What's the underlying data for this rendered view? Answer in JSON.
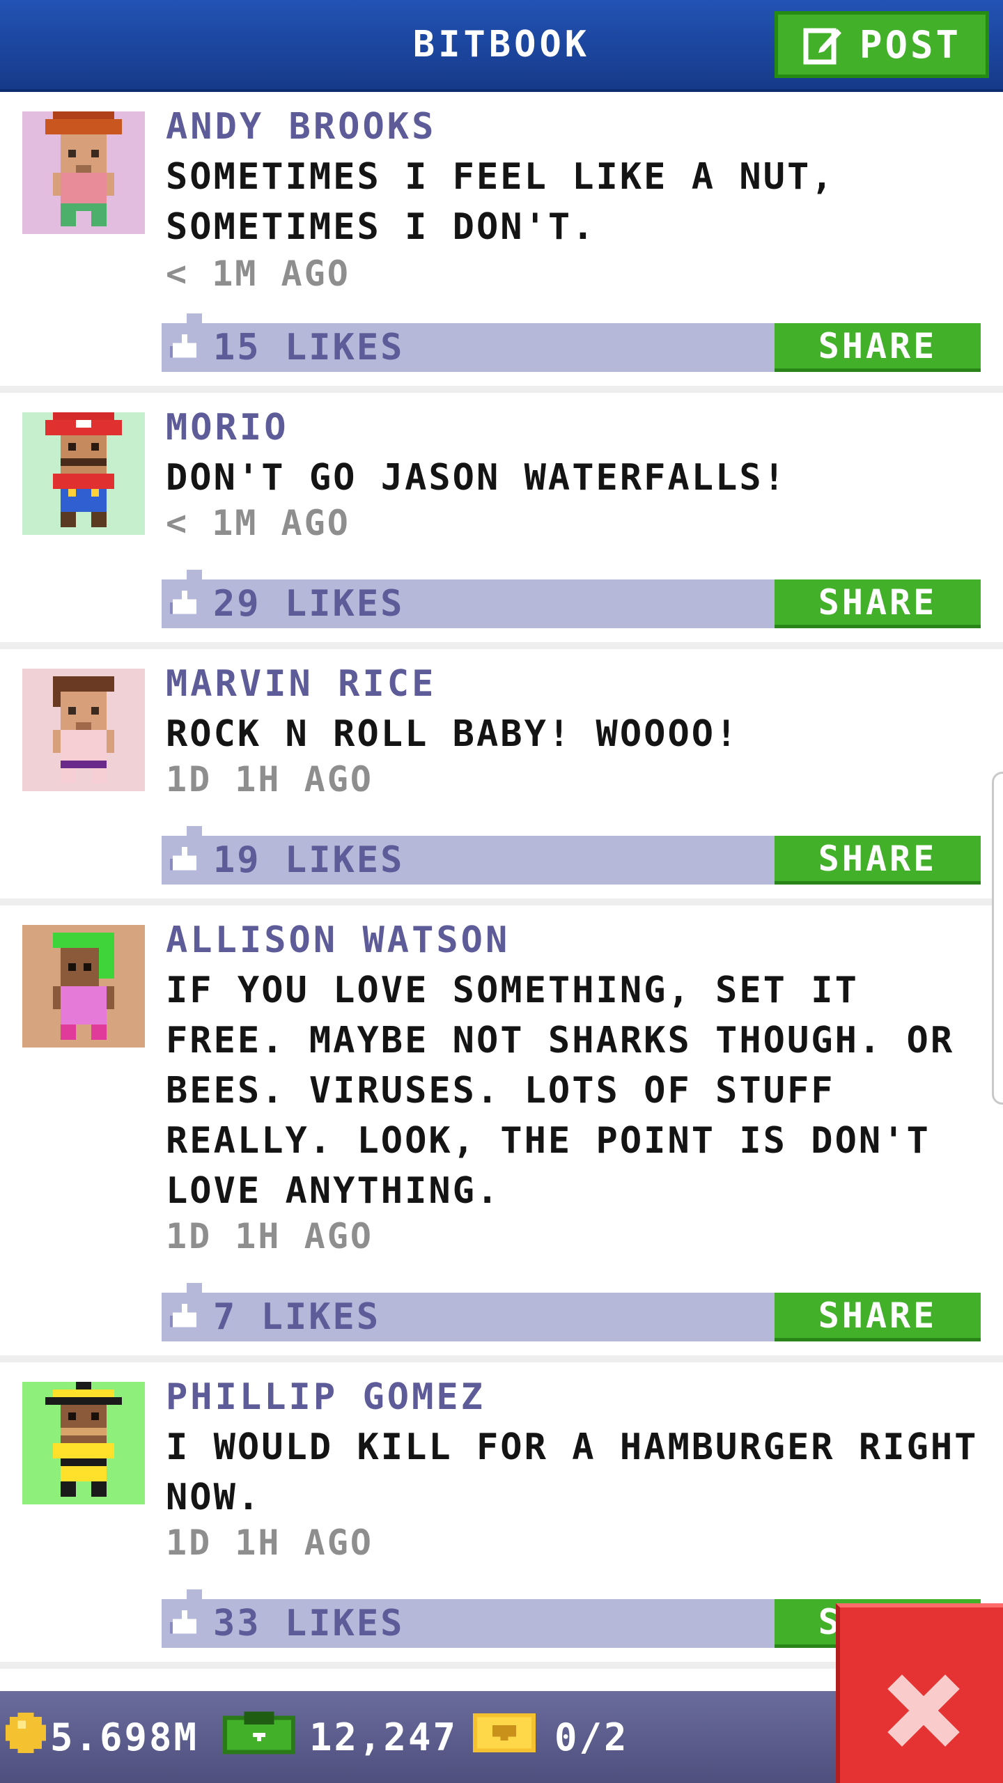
{
  "header": {
    "title": "BITBOOK",
    "post_label": "POST"
  },
  "feed": {
    "posts": [
      {
        "author": "ANDY BROOKS",
        "text": "SOMETIMES I FEEL LIKE A NUT, SOMETIMES I DON'T.",
        "time": "< 1M AGO",
        "likes": "15 LIKES",
        "share_label": "SHARE"
      },
      {
        "author": "MORIO",
        "text": "DON'T GO JASON WATERFALLS!",
        "time": "< 1M AGO",
        "likes": "29 LIKES",
        "share_label": "SHARE"
      },
      {
        "author": "MARVIN RICE",
        "text": "ROCK N ROLL BABY! WOOOO!",
        "time": "1D 1H AGO",
        "likes": "19 LIKES",
        "share_label": "SHARE"
      },
      {
        "author": "ALLISON WATSON",
        "text": "IF YOU LOVE SOMETHING, SET IT FREE. MAYBE NOT SHARKS THOUGH. OR BEES. VIRUSES. LOTS OF STUFF REALLY. LOOK, THE POINT IS DON'T LOVE ANYTHING.",
        "time": "1D 1H AGO",
        "likes": "7 LIKES",
        "share_label": "SHARE"
      },
      {
        "author": "PHILLIP GOMEZ",
        "text": "I WOULD KILL FOR A HAMBURGER RIGHT NOW.",
        "time": "1D 1H AGO",
        "likes": "33 LIKES",
        "share_label": "SHARE"
      }
    ]
  },
  "status_bar": {
    "coins": "5.698M",
    "bux": "12,247",
    "tickets": "0/2"
  },
  "icons": {
    "post": "edit-icon",
    "like": "thumbs-up-icon",
    "coins": "coin-icon",
    "bux": "bux-icon",
    "tickets": "ticket-icon",
    "close": "close-icon"
  },
  "colors": {
    "header": "#2253b4",
    "accent_green": "#43b02a",
    "like_bar": "#b6b8da",
    "author_text": "#5d5b98",
    "status_bar": "#5d5e8e",
    "close_red": "#e53232"
  }
}
